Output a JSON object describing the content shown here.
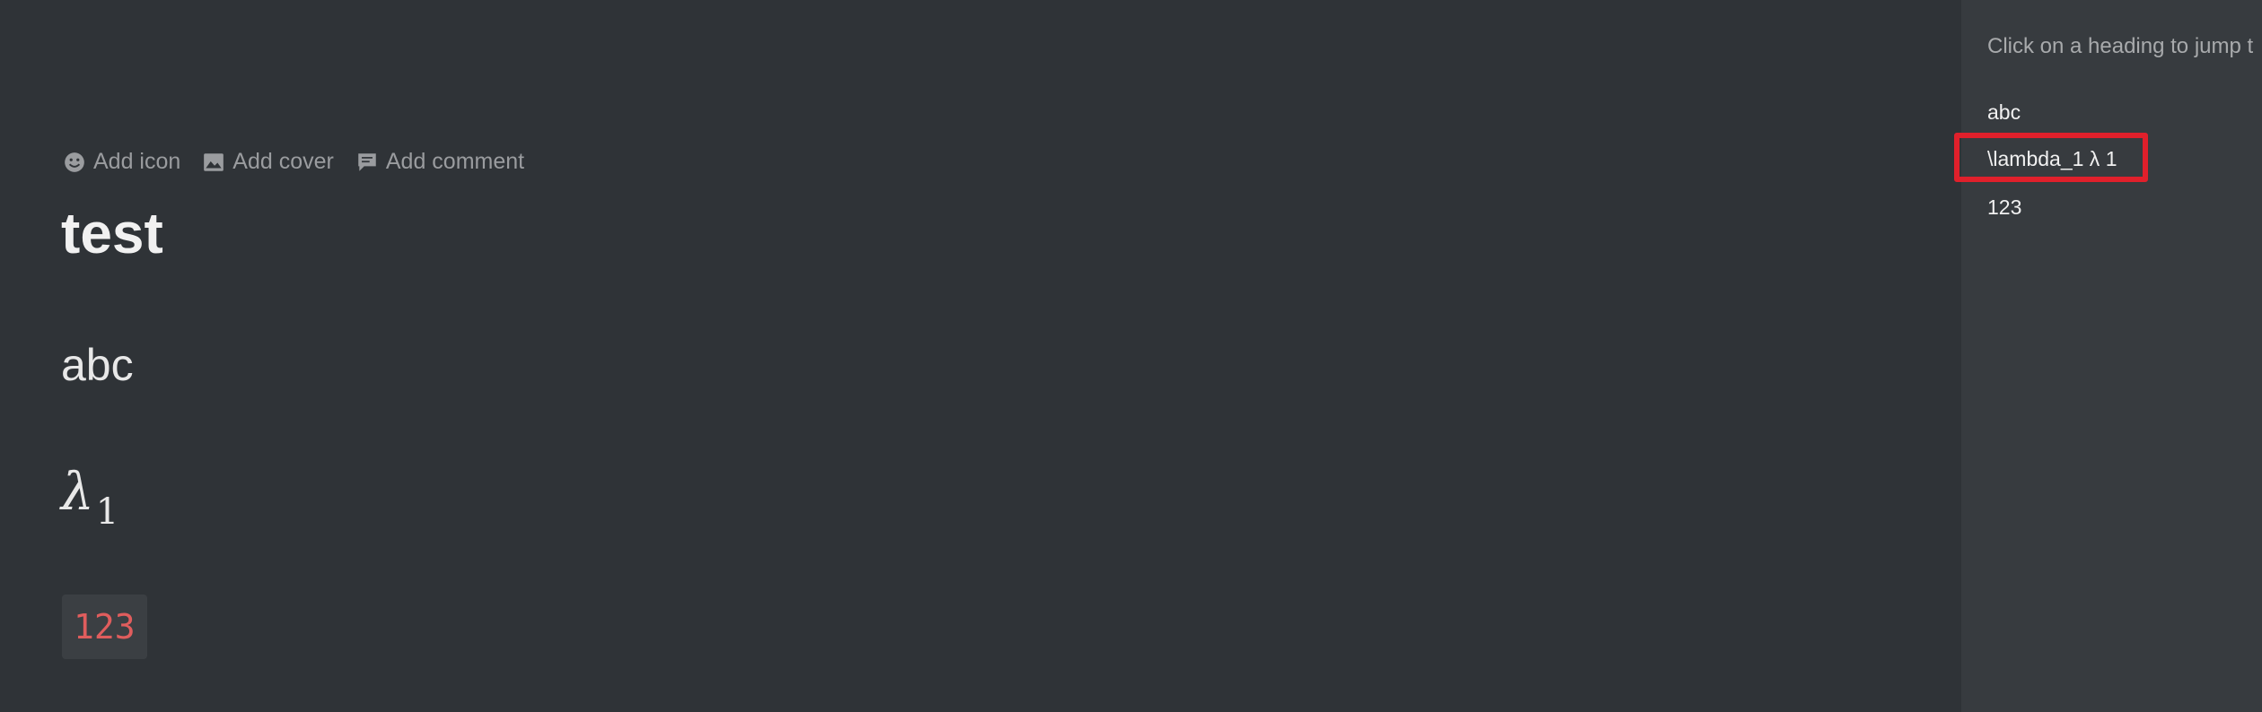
{
  "page": {
    "actions": [
      {
        "label": "Add icon",
        "icon": "smiley-icon"
      },
      {
        "label": "Add cover",
        "icon": "image-icon"
      },
      {
        "label": "Add comment",
        "icon": "comment-icon"
      }
    ],
    "title": "test",
    "headings": [
      {
        "level": 1,
        "text": "abc"
      },
      {
        "level": 2,
        "math_symbol": "λ",
        "math_subscript": "1"
      },
      {
        "level": 3,
        "text": "123"
      }
    ]
  },
  "toc": {
    "hint": "Click on a heading to jump t",
    "items": [
      {
        "label": "abc"
      },
      {
        "label": "\\lambda_1 λ 1"
      },
      {
        "label": "123"
      }
    ],
    "highlighted_index": 1
  },
  "colors": {
    "editor_bg": "#2f3337",
    "toc_bg": "#373b3f",
    "highlight": "#e0202b",
    "code_text": "#e05d5d"
  }
}
